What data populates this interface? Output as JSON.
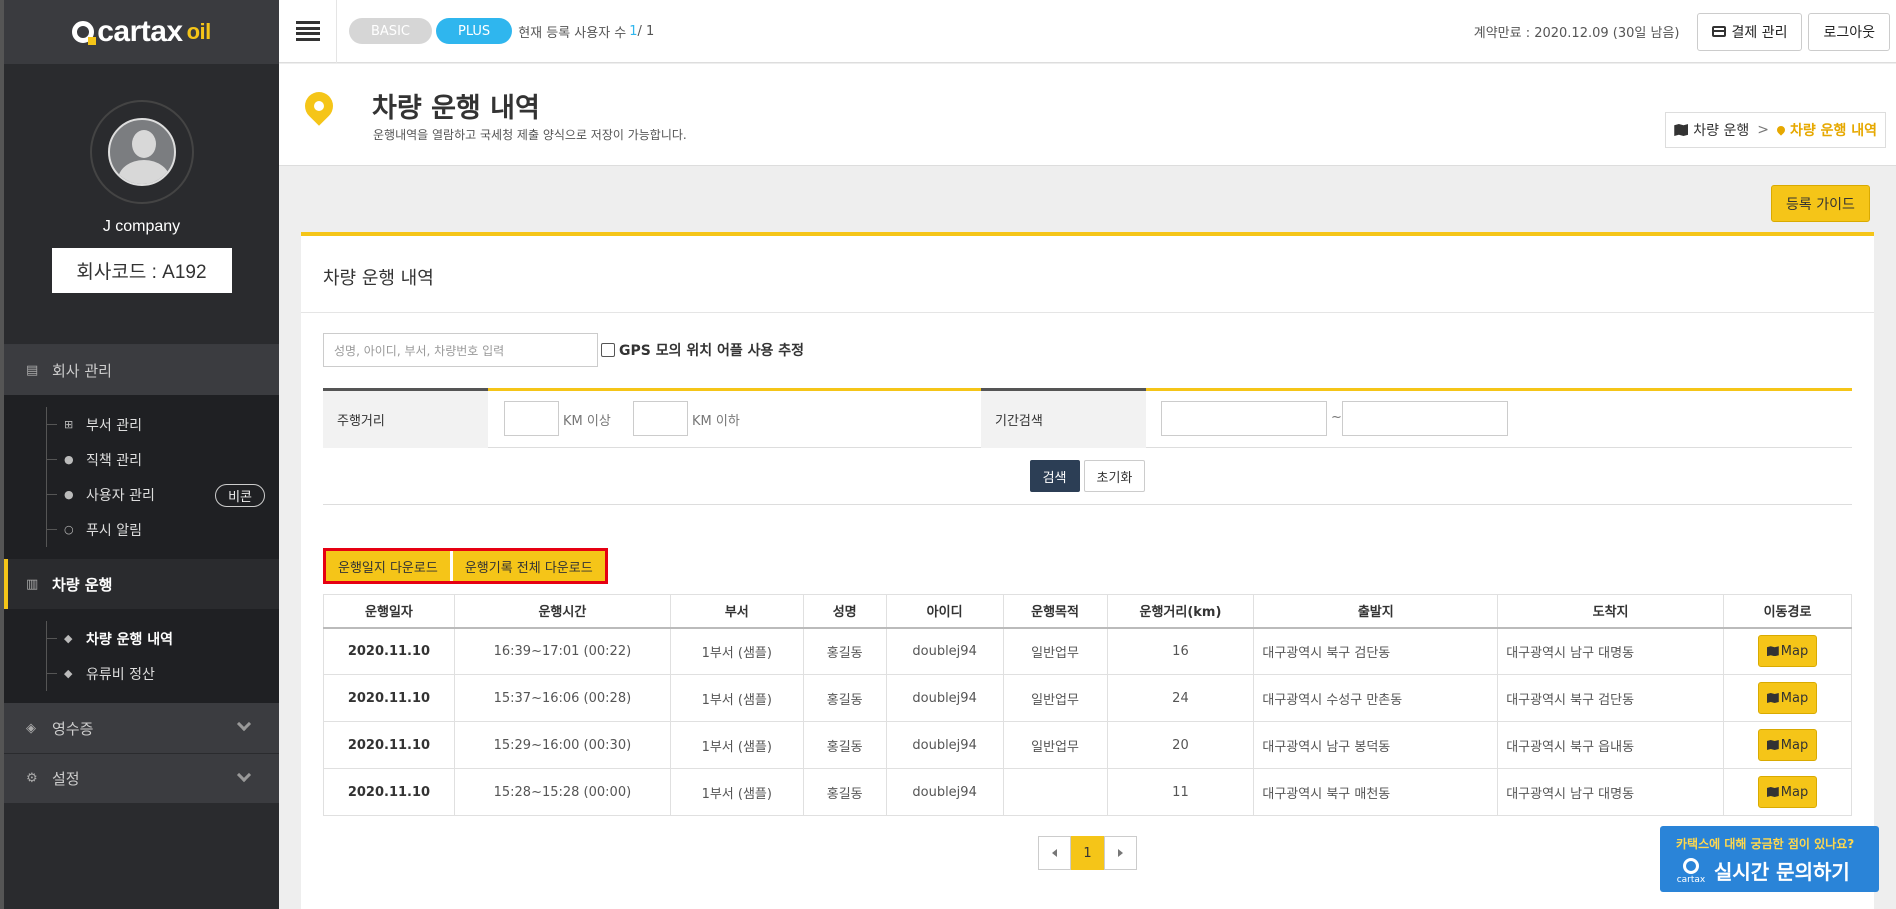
{
  "brand": {
    "name": "cartax",
    "suffix": "oil"
  },
  "profile": {
    "company": "J company",
    "code": "회사코드 : A192"
  },
  "nav": {
    "company_mgmt": "회사 관리",
    "company_items": [
      {
        "label": "부서 관리",
        "icon": "sitemap-icon"
      },
      {
        "label": "직책 관리",
        "icon": "users-icon"
      },
      {
        "label": "사용자 관리",
        "icon": "user-plus-icon",
        "badge": "비콘"
      },
      {
        "label": "푸시 알림",
        "icon": "comment-icon"
      }
    ],
    "vehicle": "차량 운행",
    "vehicle_items": [
      {
        "label": "차량 운행 내역",
        "icon": "map-marker-icon"
      },
      {
        "label": "유류비 정산",
        "icon": "tint-icon"
      }
    ],
    "receipt": "영수증",
    "settings": "설정"
  },
  "topbar": {
    "basic": "BASIC",
    "plus": "PLUS",
    "count_label": "현재 등록 사용자 수",
    "count_value": "1",
    "count_total": " / 1",
    "contract": "계약만료 : 2020.12.09 (30일 남음)",
    "payment": "결제 관리",
    "logout": "로그아웃"
  },
  "header": {
    "title": "차량 운행 내역",
    "subtitle": "운행내역을 열람하고 국세청 제출 양식으로 저장이 가능합니다.",
    "crumb_parent": "차량 운행",
    "crumb_current": "차량 운행 내역"
  },
  "guide_button": "등록 가이드",
  "panel": {
    "title": "차량 운행 내역",
    "search_placeholder": "성명, 아이디, 부서, 차량번호 입력",
    "gps_label": "GPS 모의 위치 어플 사용 추정",
    "distance_label": "주행거리",
    "km_min": "KM 이상",
    "km_max": "KM 이하",
    "period_label": "기간검색",
    "tilde": "~",
    "search_btn": "검색",
    "reset_btn": "초기화",
    "dl_log": "운행일지 다운로드",
    "dl_all": "운행기록 전체 다운로드"
  },
  "table": {
    "headers": [
      "운행일자",
      "운행시간",
      "부서",
      "성명",
      "아이디",
      "운행목적",
      "운행거리(km)",
      "출발지",
      "도착지",
      "이동경로"
    ],
    "rows": [
      {
        "date": "2020.11.10",
        "time": "16:39~17:01 (00:22)",
        "dept": "1부서 (샘플)",
        "name": "홍길동",
        "id": "doublej94",
        "purpose": "일반업무",
        "distance": "16",
        "from": "대구광역시 북구 검단동",
        "to": "대구광역시 남구 대명동",
        "map": "Map"
      },
      {
        "date": "2020.11.10",
        "time": "15:37~16:06 (00:28)",
        "dept": "1부서 (샘플)",
        "name": "홍길동",
        "id": "doublej94",
        "purpose": "일반업무",
        "distance": "24",
        "from": "대구광역시 수성구 만촌동",
        "to": "대구광역시 북구 검단동",
        "map": "Map"
      },
      {
        "date": "2020.11.10",
        "time": "15:29~16:00 (00:30)",
        "dept": "1부서 (샘플)",
        "name": "홍길동",
        "id": "doublej94",
        "purpose": "일반업무",
        "distance": "20",
        "from": "대구광역시 남구 봉덕동",
        "to": "대구광역시 북구 읍내동",
        "map": "Map"
      },
      {
        "date": "2020.11.10",
        "time": "15:28~15:28 (00:00)",
        "dept": "1부서 (샘플)",
        "name": "홍길동",
        "id": "doublej94",
        "purpose": "",
        "distance": "11",
        "from": "대구광역시 북구 매천동",
        "to": "대구광역시 남구 대명동",
        "map": "Map"
      }
    ]
  },
  "pager": {
    "current": "1"
  },
  "chat": {
    "question": "카택스에 대해 궁금한 점이 있나요?",
    "cta": "실시간 문의하기",
    "logo": "cartax"
  },
  "colors": {
    "accent": "#f5c518",
    "plus": "#2fb6ee",
    "highlight": "#e60012",
    "chat": "#2a84d8"
  }
}
